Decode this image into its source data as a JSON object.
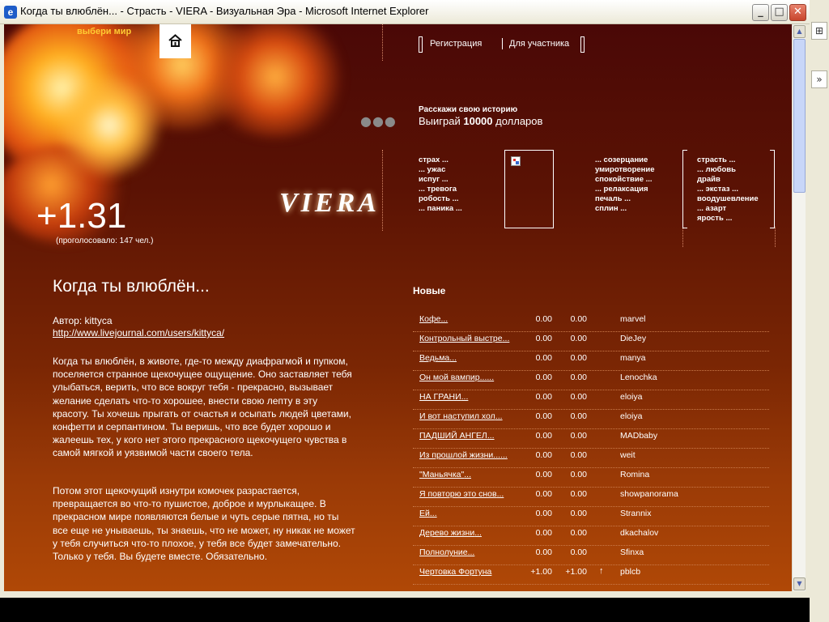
{
  "window": {
    "title": "Когда ты влюблён... - Страсть - VIERA - Визуальная Эра - Microsoft Internet Explorer",
    "min_icon": "minimize-icon",
    "max_icon": "maximize-icon",
    "close_icon": "close-icon"
  },
  "header": {
    "world_label": "выбери мир",
    "logo": "VIERA",
    "score": "+1.31",
    "votes": "(проголосовало: 147 чел.)",
    "dots": "●●●",
    "links": {
      "register": "Регистрация",
      "member": "Для участника"
    },
    "promo": {
      "line1": "Расскажи свою историю",
      "prefix": "Выиграй ",
      "amount": "10000",
      "suffix": " долларов"
    }
  },
  "emotions": {
    "left": [
      "страх ...",
      "... ужас",
      "испуг ...",
      "... тревога",
      "робость ...",
      "... паника ..."
    ],
    "middle": [
      "... созерцание",
      "умиротворение",
      "спокойствие ...",
      "... релаксация",
      "печаль ...",
      "сплин ..."
    ],
    "right": [
      "страсть ...",
      "... любовь",
      "драйв",
      "... экстаз ...",
      "воодушевление",
      "... азарт",
      "ярость ..."
    ]
  },
  "article": {
    "title": "Когда ты влюблён...",
    "author": "Автор: kittyca",
    "link": "http://www.livejournal.com/users/kittyca/",
    "para1": "Когда ты влюблён, в животе, где-то между диафрагмой и пупком, поселяется странное щекочущее ощущение. Оно заставляет тебя улыбаться, верить, что все вокруг тебя - прекрасно, вызывает желание сделать что-то хорошее, внести свою лепту в эту красоту. Ты хочешь прыгать от счастья и осыпать людей цветами, конфетти и серпантином. Ты веришь, что все будет хорошо и жалеешь тех, у кого нет этого прекрасного щекочущего чувства в самой мягкой и уязвимой части своего тела.",
    "para2": "Потом этот щекочущий изнутри комочек разрастается, превращается во что-то пушистое, доброе и мурлыкащее. В прекрасном мире появляются белые и чуть серые пятна, но ты все еще не унываешь, ты знаешь, что не может, ну никак не может у тебя случиться что-то плохое, у тебя все будет замечательно. Только у тебя. Вы будете вместе. Обязательно."
  },
  "new_list": {
    "heading": "Новые",
    "rows": [
      {
        "title": "Кофе",
        "a": "0.00",
        "b": "0.00",
        "arrow": "",
        "user": "marvel"
      },
      {
        "title": "Контрольный выстре",
        "a": "0.00",
        "b": "0.00",
        "arrow": "",
        "user": "DieJey"
      },
      {
        "title": "Ведьма",
        "a": "0.00",
        "b": "0.00",
        "arrow": "",
        "user": "manya"
      },
      {
        "title": "Он мой вампир...",
        "a": "0.00",
        "b": "0.00",
        "arrow": "",
        "user": "Lenochka"
      },
      {
        "title": "НА ГРАНИ",
        "a": "0.00",
        "b": "0.00",
        "arrow": "",
        "user": "eloiya"
      },
      {
        "title": "И вот наступил хол",
        "a": "0.00",
        "b": "0.00",
        "arrow": "",
        "user": "eloiya"
      },
      {
        "title": "ПАДШИЙ АНГЕЛ",
        "a": "0.00",
        "b": "0.00",
        "arrow": "",
        "user": "MADbaby"
      },
      {
        "title": "Из прошлой жизни...",
        "a": "0.00",
        "b": "0.00",
        "arrow": "",
        "user": "weit"
      },
      {
        "title": "\"Маньячка\"",
        "a": "0.00",
        "b": "0.00",
        "arrow": "",
        "user": "Romina"
      },
      {
        "title": "Я повторю это снов",
        "a": "0.00",
        "b": "0.00",
        "arrow": "",
        "user": "showpanorama"
      },
      {
        "title": "Ей",
        "a": "0.00",
        "b": "0.00",
        "arrow": "",
        "user": "Strannix"
      },
      {
        "title": "Дерево жизни",
        "a": "0.00",
        "b": "0.00",
        "arrow": "",
        "user": "dkachalov"
      },
      {
        "title": "Полнолуние",
        "a": "0.00",
        "b": "0.00",
        "arrow": "",
        "user": "Sfinxa"
      },
      {
        "title": "Чертовка Фортуна",
        "a": "+1.00",
        "b": "+1.00",
        "arrow": "↑",
        "user": "pblcb"
      }
    ],
    "ellipsis": "..."
  },
  "colors": {
    "accent": "#ffcc33",
    "bg_top": "#4a0806",
    "bg_bottom": "#b04806"
  }
}
